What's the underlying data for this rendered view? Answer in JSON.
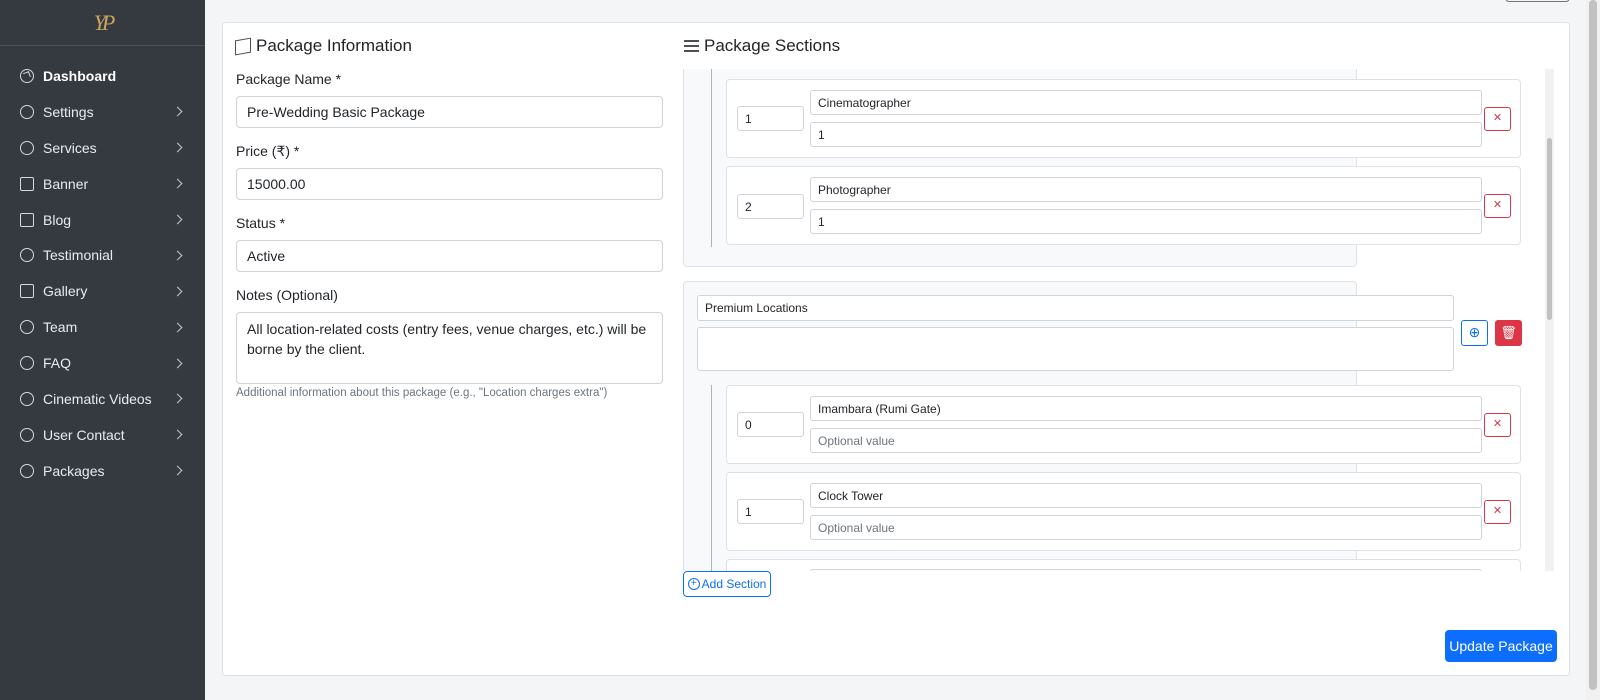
{
  "brand": {
    "logo_text": "YP"
  },
  "sidebar": {
    "items": [
      {
        "label": "Dashboard",
        "icon": "dashboard-icon",
        "active": true
      },
      {
        "label": "Settings",
        "icon": "gear-icon"
      },
      {
        "label": "Services",
        "icon": "user-circle-icon"
      },
      {
        "label": "Banner",
        "icon": "image-icon"
      },
      {
        "label": "Blog",
        "icon": "document-icon"
      },
      {
        "label": "Testimonial",
        "icon": "chat-icon"
      },
      {
        "label": "Gallery",
        "icon": "gallery-icon"
      },
      {
        "label": "Team",
        "icon": "help-circle-icon"
      },
      {
        "label": "FAQ",
        "icon": "help-circle-icon"
      },
      {
        "label": "Cinematic Videos",
        "icon": "help-circle-icon"
      },
      {
        "label": "User Contact",
        "icon": "help-circle-icon"
      },
      {
        "label": "Packages",
        "icon": "help-circle-icon"
      }
    ]
  },
  "package_info": {
    "title": "Package Information",
    "name_label": "Package Name *",
    "name_value": "Pre-Wedding Basic Package",
    "price_label": "Price (₹) *",
    "price_value": "15000.00",
    "status_label": "Status *",
    "status_value": "Active",
    "notes_label": "Notes (Optional)",
    "notes_value": "All location-related costs (entry fees, venue charges, etc.) will be borne by the client.",
    "notes_help": "Additional information about this package (e.g., \"Location charges extra\")"
  },
  "sections": {
    "title": "Package Sections",
    "section1_items": [
      {
        "order": "1",
        "name": "Cinematographer",
        "value": "1"
      },
      {
        "order": "2",
        "name": "Photographer",
        "value": "1"
      }
    ],
    "section2": {
      "title": "Premium Locations",
      "items": [
        {
          "order": "0",
          "name": "Imambara (Rumi Gate)",
          "value_placeholder": "Optional value"
        },
        {
          "order": "1",
          "name": "Clock Tower",
          "value_placeholder": "Optional value"
        }
      ]
    },
    "add_section_label": "Add Section"
  },
  "actions": {
    "update_label": "Update Package"
  },
  "colors": {
    "sidebar_bg": "#343a40",
    "primary": "#0d6efd",
    "danger": "#dc3545"
  }
}
